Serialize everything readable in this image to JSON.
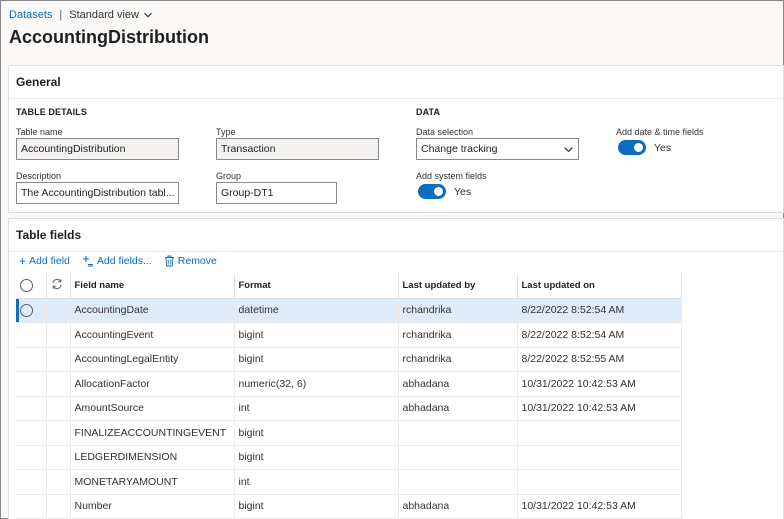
{
  "breadcrumb": {
    "root": "Datasets",
    "separator": "|",
    "view": "Standard view"
  },
  "page_title": "AccountingDistribution",
  "general": {
    "title": "General",
    "table_details_heading": "TABLE DETAILS",
    "data_heading": "DATA",
    "table_name": {
      "label": "Table name",
      "value": "AccountingDistribution"
    },
    "type": {
      "label": "Type",
      "value": "Transaction"
    },
    "description": {
      "label": "Description",
      "value": "The AccountingDistribution tabl..."
    },
    "group": {
      "label": "Group",
      "value": "Group-DT1"
    },
    "data_selection": {
      "label": "Data selection",
      "value": "Change tracking"
    },
    "add_date_time": {
      "label": "Add date & time fields",
      "state": "Yes",
      "on": true
    },
    "add_system": {
      "label": "Add system fields",
      "state": "Yes",
      "on": true
    }
  },
  "table_fields": {
    "title": "Table fields",
    "toolbar": {
      "add_field": "Add field",
      "add_fields": "Add fields...",
      "remove": "Remove"
    },
    "columns": [
      "Field name",
      "Format",
      "Last updated by",
      "Last updated on"
    ],
    "rows": [
      {
        "field": "AccountingDate",
        "format": "datetime",
        "by": "rchandrika",
        "on": "8/22/2022 8:52:54 AM",
        "selected": true
      },
      {
        "field": "AccountingEvent",
        "format": "bigint",
        "by": "rchandrika",
        "on": "8/22/2022 8:52:54 AM"
      },
      {
        "field": "AccountingLegalEntity",
        "format": "bigint",
        "by": "rchandrika",
        "on": "8/22/2022 8:52:55 AM"
      },
      {
        "field": "AllocationFactor",
        "format": "numeric(32, 6)",
        "by": "abhadana",
        "on": "10/31/2022 10:42:53 AM"
      },
      {
        "field": "AmountSource",
        "format": "int",
        "by": "abhadana",
        "on": "10/31/2022 10:42:53 AM"
      },
      {
        "field": "FINALIZEACCOUNTINGEVENT",
        "format": "bigint",
        "by": "",
        "on": ""
      },
      {
        "field": "LEDGERDIMENSION",
        "format": "bigint",
        "by": "",
        "on": ""
      },
      {
        "field": "MONETARYAMOUNT",
        "format": "int",
        "by": "",
        "on": ""
      },
      {
        "field": "Number",
        "format": "bigint",
        "by": "abhadana",
        "on": "10/31/2022 10:42:53 AM"
      }
    ]
  },
  "colors": {
    "accent": "#0f6cbd",
    "selected_row": "#deecf9"
  },
  "icons": [
    "chevron-down-icon",
    "plus-icon",
    "add-multiple-icon",
    "trash-icon",
    "refresh-icon",
    "radio-icon"
  ]
}
